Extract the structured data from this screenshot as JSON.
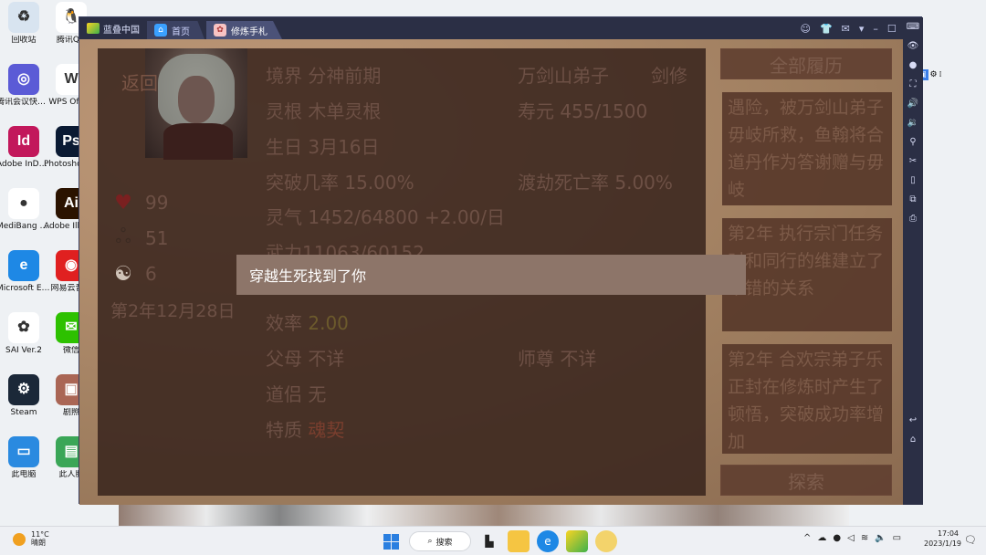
{
  "desktop": {
    "icons_col1": [
      {
        "label": "回收站",
        "icon": "recycle-bin-icon",
        "color": "#d8e4f0",
        "glyph": "♻"
      },
      {
        "label": "腾讯会议快捷方式 图标",
        "icon": "tencent-meeting-icon",
        "color": "#5b5bd6",
        "glyph": "◎"
      },
      {
        "label": "Adobe InDesi...",
        "icon": "indesign-icon",
        "color": "#c2185b",
        "glyph": "Id"
      },
      {
        "label": "MediBang Paint Pro",
        "icon": "medibang-icon",
        "color": "#ffffff",
        "glyph": "●"
      },
      {
        "label": "Microsoft Edge",
        "icon": "edge-icon",
        "color": "#1e88e5",
        "glyph": "e"
      },
      {
        "label": "SAI Ver.2",
        "icon": "sai-icon",
        "color": "#ffffff",
        "glyph": "✿"
      },
      {
        "label": "Steam",
        "icon": "steam-icon",
        "color": "#1b2838",
        "glyph": "⚙"
      },
      {
        "label": "此电脑",
        "icon": "this-pc-icon",
        "color": "#2a8ae0",
        "glyph": "▭"
      }
    ],
    "icons_col2": [
      {
        "label": "腾讯QQ",
        "icon": "qq-icon",
        "color": "#ffffff",
        "glyph": "🐧"
      },
      {
        "label": "WPS Office",
        "icon": "wps-icon",
        "color": "#ffffff",
        "glyph": "W"
      },
      {
        "label": "Photoshop 快捷方式",
        "icon": "photoshop-icon",
        "color": "#0a1a33",
        "glyph": "Ps"
      },
      {
        "label": "Adobe Illustrator",
        "icon": "illustrator-icon",
        "color": "#2b1300",
        "glyph": "Ai"
      },
      {
        "label": "网易云音乐",
        "icon": "netease-music-icon",
        "color": "#e02020",
        "glyph": "◉"
      },
      {
        "label": "微信",
        "icon": "wechat-icon",
        "color": "#2dc100",
        "glyph": "✉"
      },
      {
        "label": "剧照",
        "icon": "photo-icon",
        "color": "#aa6655",
        "glyph": "▣"
      },
      {
        "label": "此人脸",
        "icon": "app-icon",
        "color": "#3aa657",
        "glyph": "▤"
      }
    ]
  },
  "emulator": {
    "logo_text": "蓝叠中国",
    "tabs": [
      {
        "label": "首页",
        "active": false
      },
      {
        "label": "修炼手札",
        "active": true
      }
    ],
    "toolbar_icons": [
      "account-icon",
      "shirt-icon",
      "mail-icon",
      "dropdown-icon",
      "minimize-icon",
      "maximize-icon",
      "close-icon"
    ],
    "toolbar_glyphs": [
      "☺",
      "👕",
      "✉",
      "▾",
      "–",
      "☐",
      "✕"
    ],
    "side_icons": [
      "keyboard-icon",
      "eye-icon",
      "record-icon",
      "fullscreen-icon",
      "volume-up-icon",
      "volume-down-icon",
      "location-icon",
      "scissors-icon",
      "shake-icon",
      "multi-instance-icon",
      "screenshot-icon",
      "back-icon",
      "home-icon"
    ],
    "side_glyphs": [
      "⌨",
      "👁",
      "●",
      "⛶",
      "🔊",
      "🔉",
      "⚲",
      "✂",
      "▯",
      "⧉",
      "⎙",
      "↩",
      "⌂"
    ]
  },
  "game": {
    "back_label": "返回",
    "realm": {
      "label": "境界",
      "value": "分神前期"
    },
    "sect": "万剑山弟子",
    "class": "剑修",
    "root": {
      "label": "灵根",
      "value": "木单灵根"
    },
    "lifespan": {
      "label": "寿元",
      "value": "455/1500"
    },
    "birthday": {
      "label": "生日",
      "value": "3月16日"
    },
    "breakthrough": {
      "label": "突破几率",
      "value": "15.00%"
    },
    "tribulation": {
      "label": "渡劫死亡率",
      "value": "5.00%"
    },
    "spirit": {
      "label": "灵气",
      "value": "1452/64800 +2.00/日"
    },
    "force": {
      "label": "武力",
      "value": "11063/60152"
    },
    "efficiency": {
      "label": "效率",
      "value": "2.00"
    },
    "parents": {
      "label": "父母",
      "value": "不详"
    },
    "master": {
      "label": "师尊",
      "value": "不详"
    },
    "partner": {
      "label": "道侣",
      "value": "无"
    },
    "trait": {
      "label": "特质",
      "value": "魂契"
    },
    "stats": [
      {
        "icon": "heart-icon",
        "glyph": "♥",
        "color": "#7a2020",
        "value": "99"
      },
      {
        "icon": "footprints-icon",
        "glyph": "ஃ",
        "color": "#3a2a22",
        "value": "51"
      },
      {
        "icon": "yin-yang-icon",
        "glyph": "☯",
        "color": "#cfc3b8",
        "value": "6"
      }
    ],
    "date": "第2年12月28日",
    "all_history_label": "全部履历",
    "events": [
      "遇险，被万剑山弟子毋岐所救，鱼翰将合道丹作为答谢赠与毋岐",
      "第2年 执行宗门任务时和同行的维建立了不错的关系",
      "第2年 合欢宗弟子乐正封在修炼时产生了顿悟，突破成功率增加"
    ],
    "explore_label": "探索",
    "toast": "穿越生死找到了你"
  },
  "taskbar": {
    "weather_temp": "11°C",
    "weather_desc": "晴朗",
    "search_label": "搜索",
    "apps": [
      "start-icon",
      "search-button",
      "task-view-icon",
      "file-explorer-icon",
      "edge-icon",
      "bluestacks-icon",
      "app-icon"
    ],
    "tray_glyphs": [
      "^",
      "☁",
      "●",
      "◁",
      "≋",
      "🔈",
      "▭"
    ],
    "time": "17:04",
    "date": "2023/1/19"
  }
}
